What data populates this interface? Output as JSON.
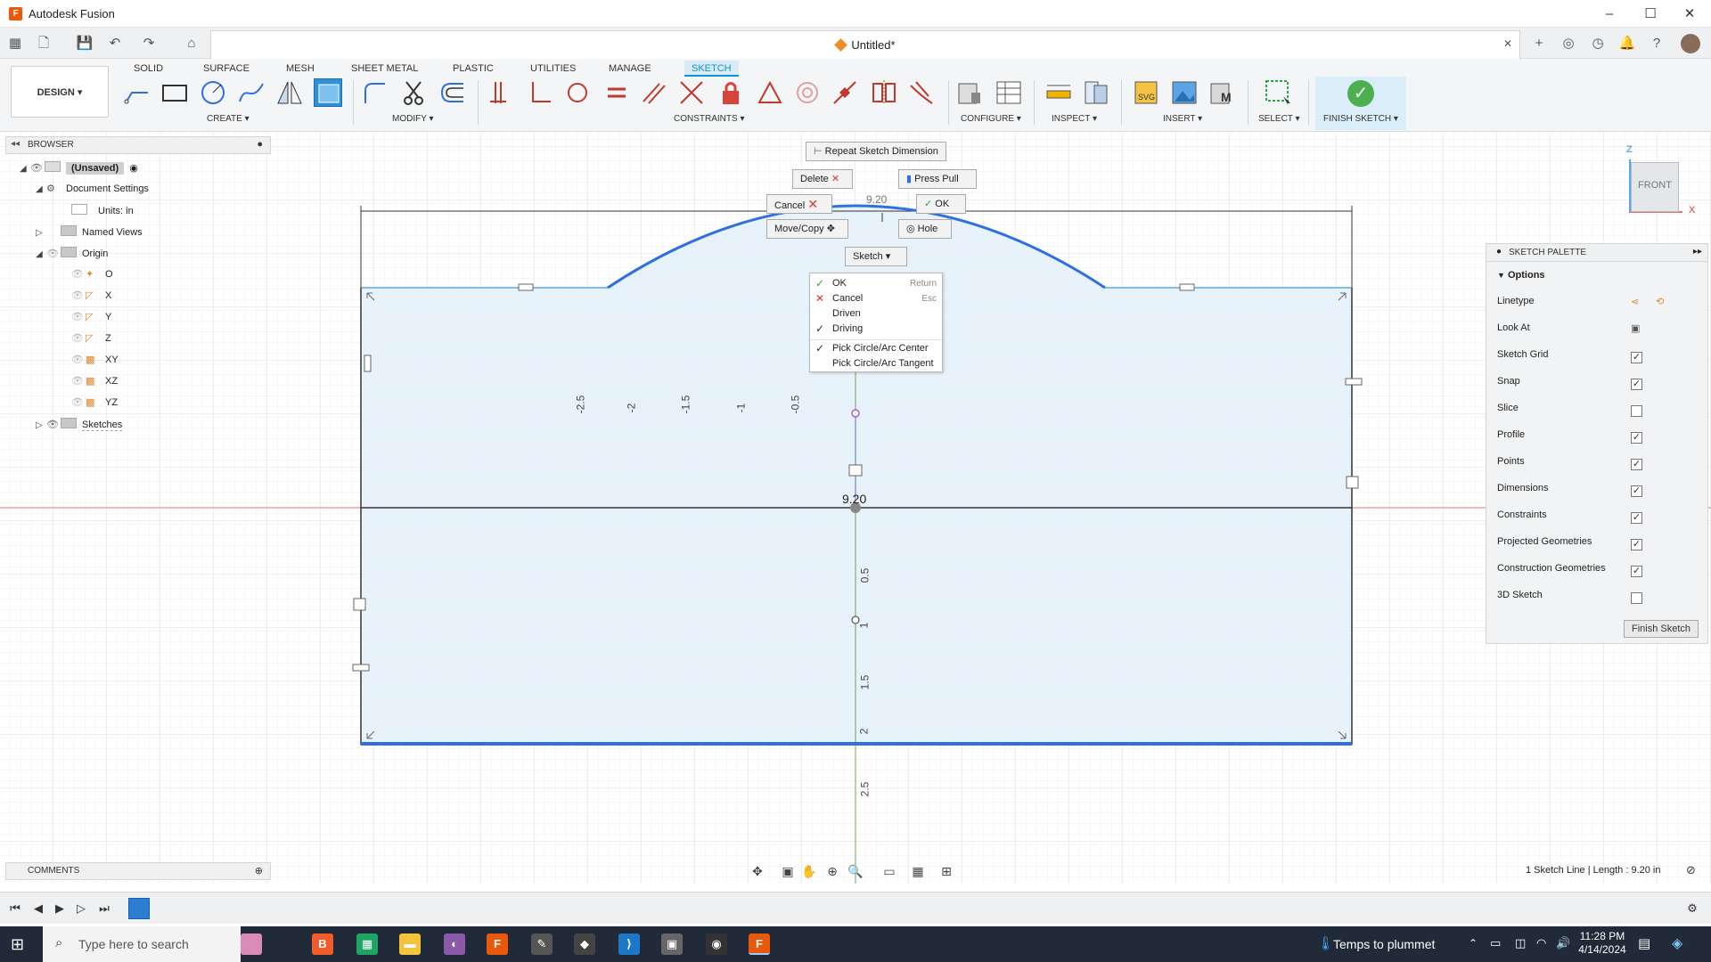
{
  "window": {
    "title": "Autodesk Fusion",
    "minimize": "–",
    "maximize": "☐",
    "close": "✕"
  },
  "document": {
    "name": "Untitled*",
    "close": "✕"
  },
  "ribbon": {
    "workspace": "DESIGN ▾",
    "tabs": [
      "SOLID",
      "SURFACE",
      "MESH",
      "SHEET METAL",
      "PLASTIC",
      "UTILITIES",
      "MANAGE",
      "SKETCH"
    ],
    "active_tab": "SKETCH",
    "groups": {
      "create": "CREATE ▾",
      "modify": "MODIFY ▾",
      "constraints": "CONSTRAINTS ▾",
      "configure": "CONFIGURE ▾",
      "inspect": "INSPECT ▾",
      "insert": "INSERT ▾",
      "select": "SELECT ▾",
      "finish": "FINISH SKETCH ▾"
    }
  },
  "browser": {
    "title": "BROWSER",
    "items": [
      {
        "label": "(Unsaved)"
      },
      {
        "label": "Document Settings"
      },
      {
        "label": "Units: in"
      },
      {
        "label": "Named Views"
      },
      {
        "label": "Origin"
      },
      {
        "label": "O"
      },
      {
        "label": "X"
      },
      {
        "label": "Y"
      },
      {
        "label": "Z"
      },
      {
        "label": "XY"
      },
      {
        "label": "XZ"
      },
      {
        "label": "YZ"
      },
      {
        "label": "Sketches"
      }
    ]
  },
  "comments": {
    "title": "COMMENTS"
  },
  "marking_menu": {
    "repeat": "Repeat Sketch Dimension",
    "delete": "Delete",
    "press_pull": "Press Pull",
    "cancel": "Cancel",
    "ok": "OK",
    "move_copy": "Move/Copy",
    "hole": "Hole",
    "sketch_dropdown": "Sketch"
  },
  "context_menu": {
    "items": [
      {
        "label": "OK",
        "key": "Return"
      },
      {
        "label": "Cancel",
        "key": "Esc"
      },
      {
        "label": "Driven",
        "key": ""
      },
      {
        "label": "Driving",
        "key": ""
      },
      {
        "label": "Pick Circle/Arc Center",
        "key": ""
      },
      {
        "label": "Pick Circle/Arc Tangent",
        "key": ""
      }
    ]
  },
  "viewport": {
    "dimension_top": "9.20",
    "dimension_center": "9.20",
    "ruler_h": [
      "-2.5",
      "-2",
      "-1.5",
      "-1",
      "-0.5"
    ],
    "ruler_v": [
      "0.5",
      "1",
      "1.5",
      "2",
      "2.5"
    ],
    "viewcube": "FRONT",
    "axis_z": "Z",
    "axis_x": "X"
  },
  "palette": {
    "title": "SKETCH PALETTE",
    "options": "Options",
    "rows": [
      {
        "label": "Linetype",
        "checked": null
      },
      {
        "label": "Look At",
        "checked": null
      },
      {
        "label": "Sketch Grid",
        "checked": true
      },
      {
        "label": "Snap",
        "checked": true
      },
      {
        "label": "Slice",
        "checked": false
      },
      {
        "label": "Profile",
        "checked": true
      },
      {
        "label": "Points",
        "checked": true
      },
      {
        "label": "Dimensions",
        "checked": true
      },
      {
        "label": "Constraints",
        "checked": true
      },
      {
        "label": "Projected Geometries",
        "checked": true
      },
      {
        "label": "Construction Geometries",
        "checked": true
      },
      {
        "label": "3D Sketch",
        "checked": false
      }
    ],
    "finish": "Finish Sketch"
  },
  "status": {
    "text": "1 Sketch Line | Length : 9.20 in"
  },
  "taskbar": {
    "search": "Type here to search",
    "weather": "Temps to plummet",
    "time": "11:28 PM",
    "date": "4/14/2024"
  },
  "colors": {
    "accent": "#0696d7",
    "sketch_line": "#2f6fe0",
    "profile_fill": "#e4f1fb",
    "finish_green": "#4cb050"
  }
}
